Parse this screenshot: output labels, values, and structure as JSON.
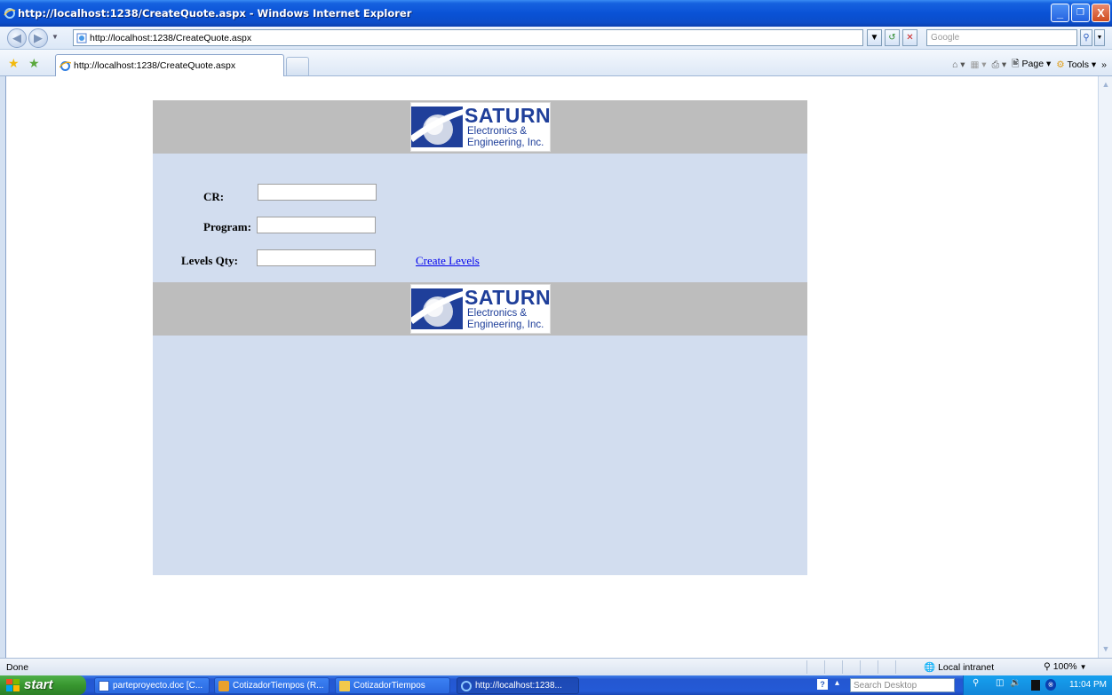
{
  "window": {
    "title": "http://localhost:1238/CreateQuote.aspx - Windows Internet Explorer",
    "minimize": "_",
    "restore": "❐",
    "close": "X"
  },
  "addressbar": {
    "url": "http://localhost:1238/CreateQuote.aspx",
    "search_placeholder": "Google"
  },
  "tabs": [
    {
      "label": "http://localhost:1238/CreateQuote.aspx"
    }
  ],
  "commandbar": {
    "page": "Page",
    "tools": "Tools"
  },
  "logo": {
    "brand": "SATURN",
    "line1": "Electronics &",
    "line2": "Engineering, Inc."
  },
  "form": {
    "cr_label": "CR:",
    "program_label": "Program:",
    "levels_label": "Levels Qty:",
    "create_levels": "Create Levels",
    "cr_value": "",
    "program_value": "",
    "levels_value": ""
  },
  "statusbar": {
    "status": "Done",
    "zone": "Local intranet",
    "zoom": "100%"
  },
  "taskbar": {
    "start": "start",
    "tasks": [
      {
        "label": "parteproyecto.doc [C..."
      },
      {
        "label": "CotizadorTiempos (R..."
      },
      {
        "label": "CotizadorTiempos"
      },
      {
        "label": "http://localhost:1238..."
      }
    ],
    "desktop_search_placeholder": "Search Desktop",
    "clock": "11:04 PM"
  },
  "colors": {
    "panel_bg": "#d2ddef",
    "banner_bg": "#bdbdbd",
    "brand_blue": "#1f3f9a",
    "link": "#0000ee"
  }
}
